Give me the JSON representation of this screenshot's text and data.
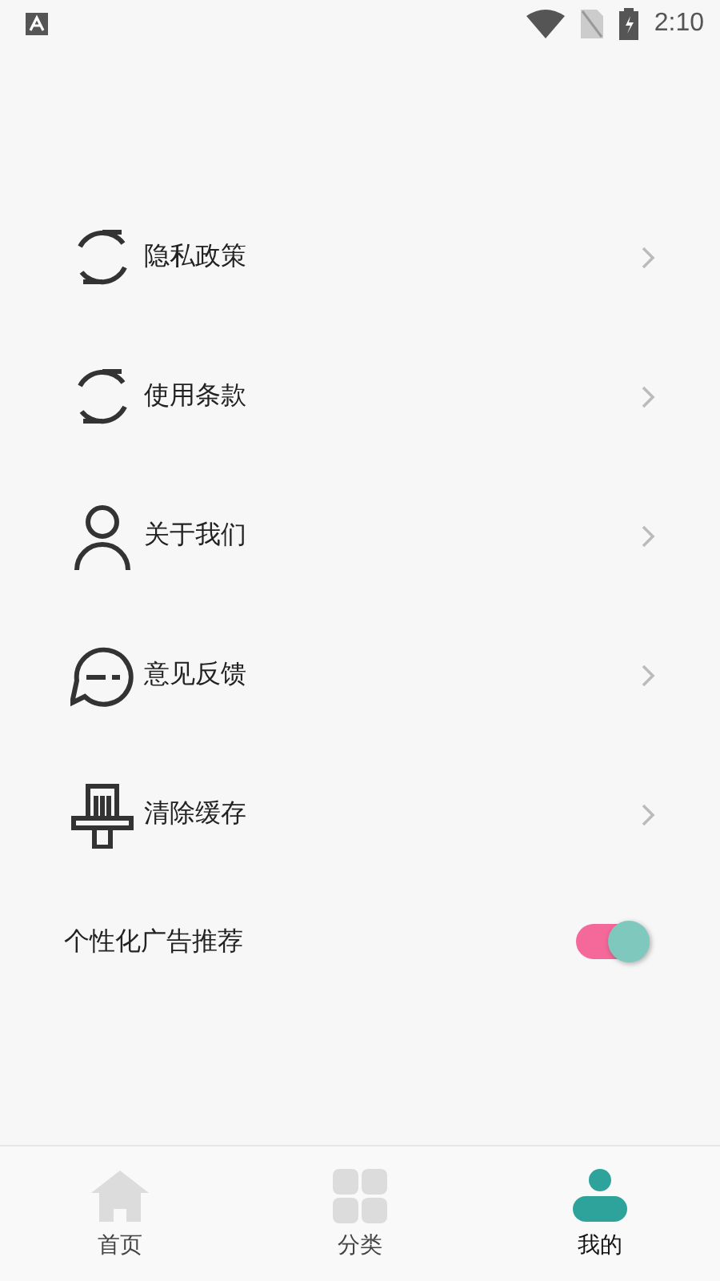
{
  "status_bar": {
    "time": "2:10"
  },
  "menu": [
    {
      "label": "隐私政策",
      "kind": "refresh"
    },
    {
      "label": "使用条款",
      "kind": "refresh"
    },
    {
      "label": "关于我们",
      "kind": "person"
    },
    {
      "label": "意见反馈",
      "kind": "chat"
    },
    {
      "label": "清除缓存",
      "kind": "brush"
    }
  ],
  "ad_setting": {
    "label": "个性化广告推荐",
    "on": true
  },
  "bottom_nav": [
    {
      "label": "首页",
      "kind": "home",
      "selected": false
    },
    {
      "label": "分类",
      "kind": "grid",
      "selected": false
    },
    {
      "label": "我的",
      "kind": "person",
      "selected": true
    }
  ]
}
